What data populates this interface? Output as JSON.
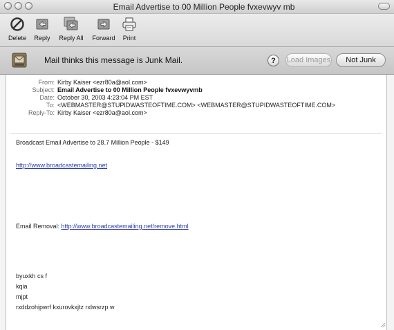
{
  "window": {
    "title": "Email Advertise to 00 Million People fvxevwyv mb"
  },
  "toolbar": {
    "delete_label": "Delete",
    "reply_label": "Reply",
    "reply_all_label": "Reply All",
    "forward_label": "Forward",
    "print_label": "Print"
  },
  "junk_bar": {
    "message": "Mail thinks this message is Junk Mail.",
    "help_label": "?",
    "load_images_label": "Load Images",
    "not_junk_label": "Not Junk"
  },
  "headers": {
    "from_key": "From:",
    "from_value": "Kirby Kaiser <ezr80a@aol.com>",
    "subject_key": "Subject:",
    "subject_value": "Email Advertise to 00 Million People fvxevwyvmb",
    "date_key": "Date:",
    "date_value": "October 30, 2003 4:23:04 PM EST",
    "to_key": "To:",
    "to_value": "<WEBMASTER@STUPIDWASTEOFTIME.COM> <WEBMASTER@STUPIDWASTEOFTIME.COM>",
    "replyto_key": "Reply-To:",
    "replyto_value": "Kirby Kaiser <ezr80a@aol.com>"
  },
  "body": {
    "line1": "Broadcast Email Advertise to 28.7 Million People - $149",
    "link1": "http://www.broadcastemailing.net",
    "removal_label": "Email Removal:",
    "removal_link": "http://www.broadcastemailing.net/remove.html",
    "junk_line1": "byuxkh cs f",
    "junk_line2": "kqia",
    "junk_line3": "mjpt",
    "junk_line4": "rxddzohipwrf kxurovkxjtz  rxlwsrzp w"
  },
  "icons": {
    "delete": "delete-icon",
    "reply": "reply-icon",
    "reply_all": "reply-all-icon",
    "forward": "forward-icon",
    "print": "print-icon",
    "junk": "junk-mail-icon"
  }
}
